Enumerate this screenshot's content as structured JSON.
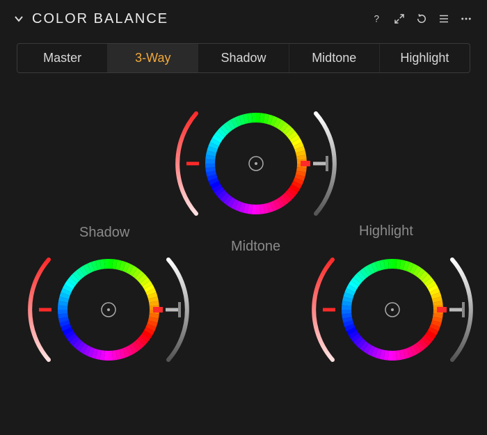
{
  "header": {
    "title": "COLOR BALANCE",
    "icons": {
      "help": "help-icon",
      "expand": "expand-icon",
      "reset": "reset-icon",
      "menu": "menu-icon",
      "more": "more-icon"
    }
  },
  "tabs": [
    {
      "label": "Master",
      "active": false
    },
    {
      "label": "3-Way",
      "active": true
    },
    {
      "label": "Shadow",
      "active": false
    },
    {
      "label": "Midtone",
      "active": false
    },
    {
      "label": "Highlight",
      "active": false
    }
  ],
  "wheels": [
    {
      "id": "shadow",
      "label": "Shadow",
      "hue": 0,
      "saturation": 0,
      "lightness": 0
    },
    {
      "id": "midtone",
      "label": "Midtone",
      "hue": 0,
      "saturation": 0,
      "lightness": 0
    },
    {
      "id": "highlight",
      "label": "Highlight",
      "hue": 0,
      "saturation": 0,
      "lightness": 0
    }
  ],
  "colors": {
    "accent": "#f2a83a",
    "panel_bg": "#1a1a1a",
    "text": "#d8d8d8",
    "muted": "#8a8a8a"
  }
}
